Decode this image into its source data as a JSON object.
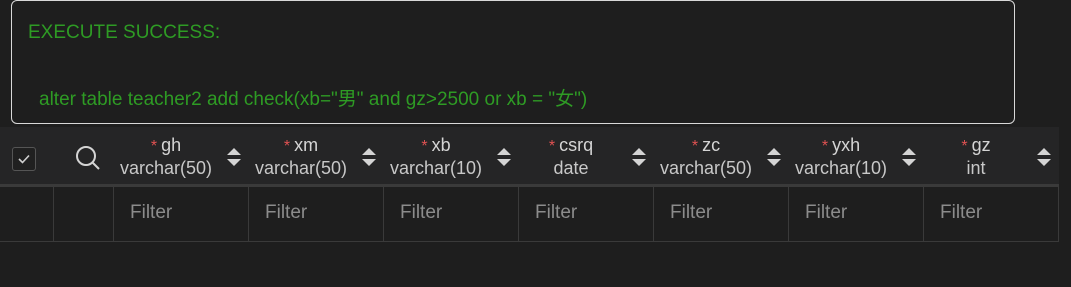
{
  "result": {
    "status": "EXECUTE SUCCESS:",
    "sql": "alter table teacher2 add check(xb=\"男\" and gz>2500 or xb = \"女\")"
  },
  "grid": {
    "columns": [
      {
        "name": "gh",
        "type": "varchar(50)",
        "required": "*"
      },
      {
        "name": "xm",
        "type": "varchar(50)",
        "required": "*"
      },
      {
        "name": "xb",
        "type": "varchar(10)",
        "required": "*"
      },
      {
        "name": "csrq",
        "type": "date",
        "required": "*"
      },
      {
        "name": "zc",
        "type": "varchar(50)",
        "required": "*"
      },
      {
        "name": "yxh",
        "type": "varchar(10)",
        "required": "*"
      },
      {
        "name": "gz",
        "type": "int",
        "required": "*"
      }
    ],
    "filter_placeholder": "Filter"
  }
}
